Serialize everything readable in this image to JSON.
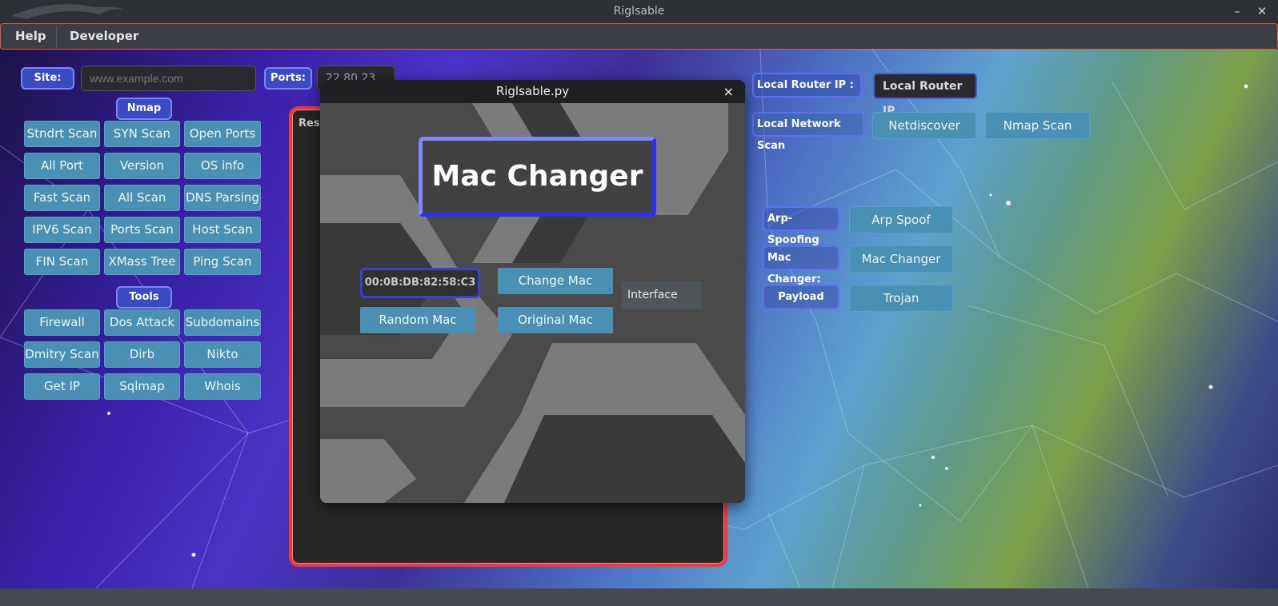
{
  "window": {
    "title": "Riglsable",
    "minimize_icon": "minimize-icon",
    "close_icon": "close-icon"
  },
  "menu": {
    "items": [
      "Help",
      "Developer"
    ]
  },
  "target": {
    "site_label": "Site:",
    "site_placeholder": "www.example.com",
    "ports_label": "Ports:",
    "ports_value": "22,80,23"
  },
  "nmap": {
    "label": "Nmap",
    "buttons": [
      "Stndrt Scan",
      "SYN Scan",
      "Open Ports",
      "All Port Scan",
      "Version Scan",
      "OS info Scan",
      "Fast Scan",
      "All Scan",
      "DNS Parsing",
      "IPV6 Scan",
      "Ports Scan",
      "Host Scan",
      "FIN Scan",
      "XMass Tree",
      "Ping Scan"
    ]
  },
  "tools": {
    "label": "Tools",
    "buttons": [
      "Firewall Scan",
      "Dos Attack",
      "Subdomains",
      "Dmitry Scan",
      "Dirb",
      "Nikto",
      "Get IP",
      "Sqlmap",
      "Whois"
    ]
  },
  "results": {
    "title": "Resu"
  },
  "right": {
    "router_label": "Local Router IP :",
    "router_placeholder": "Local Router IP",
    "network_label": "Local Network Scan",
    "netdiscover": "Netdiscover",
    "nmap_scan": "Nmap Scan",
    "arp_label": "Arp-Spoofing",
    "arp_button": "Arp Spoof",
    "mac_label": "Mac Changer:",
    "mac_button": "Mac Changer",
    "payload_label": "Payload",
    "payload_button": "Trojan"
  },
  "dialog": {
    "title": "Riglsable.py",
    "close": "×",
    "heading": "Mac Changer",
    "mac_value": "00:0B:DB:82:58:C3",
    "change_mac": "Change Mac",
    "random_mac": "Random Mac",
    "original_mac": "Original Mac",
    "interface": "Interface"
  },
  "colors": {
    "button": "#4a90b4",
    "label": "#3a4ac0",
    "results_border": "#f03a3a",
    "heading_border": "#2d2cff"
  }
}
